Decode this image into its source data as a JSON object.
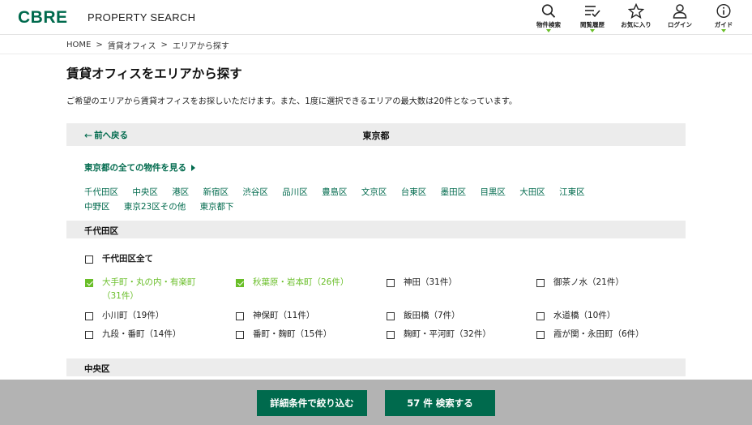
{
  "header": {
    "logo": "CBRE",
    "site_title": "PROPERTY SEARCH",
    "nav": [
      {
        "label": "物件検索",
        "icon": "search-icon"
      },
      {
        "label": "閲覧履歴",
        "icon": "history-list-icon"
      },
      {
        "label": "お気に入り",
        "icon": "star-icon"
      },
      {
        "label": "ログイン",
        "icon": "user-icon"
      },
      {
        "label": "ガイド",
        "icon": "info-icon"
      }
    ]
  },
  "breadcrumb": {
    "items": [
      "HOME",
      "賃貸オフィス",
      "エリアから探す"
    ],
    "separator": ">"
  },
  "page": {
    "title": "賃貸オフィスをエリアから探す",
    "intro": "ご希望のエリアから賃貸オフィスをお探しいただけます。また、1度に選択できるエリアの最大数は20件となっています。"
  },
  "region": {
    "back_label": "前へ戻る",
    "title": "東京都",
    "all_link": "東京都の全ての物件を見る",
    "wards_row1": [
      "千代田区",
      "中央区",
      "港区",
      "新宿区",
      "渋谷区",
      "品川区",
      "豊島区",
      "文京区",
      "台東区",
      "墨田区",
      "目黒区",
      "大田区",
      "江東区"
    ],
    "wards_row2": [
      "中野区",
      "東京23区その他",
      "東京都下"
    ]
  },
  "sections": {
    "chiyoda": {
      "title": "千代田区",
      "all_label": "千代田区全て",
      "items": [
        {
          "label": "大手町・丸の内・有楽町",
          "count": "（31件）",
          "checked": true
        },
        {
          "label": "秋葉原・岩本町（26件）",
          "checked": true
        },
        {
          "label": "神田（31件）",
          "checked": false
        },
        {
          "label": "御茶ノ水（21件）",
          "checked": false
        },
        {
          "label": "小川町（19件）",
          "checked": false
        },
        {
          "label": "神保町（11件）",
          "checked": false
        },
        {
          "label": "飯田橋（7件）",
          "checked": false
        },
        {
          "label": "水道橋（10件）",
          "checked": false
        },
        {
          "label": "九段・番町（14件）",
          "checked": false
        },
        {
          "label": "番町・麹町（15件）",
          "checked": false
        },
        {
          "label": "麹町・平河町（32件）",
          "checked": false
        },
        {
          "label": "霞が関・永田町（6件）",
          "checked": false
        }
      ]
    },
    "chuo": {
      "title": "中央区"
    }
  },
  "footer": {
    "filter_button": "詳細条件で絞り込む",
    "search_button": "57 件 検索する"
  },
  "colors": {
    "brand_green": "#006a4d",
    "accent_green": "#69be28",
    "section_bg": "#ececec",
    "footer_bg": "#b3b3b3"
  }
}
